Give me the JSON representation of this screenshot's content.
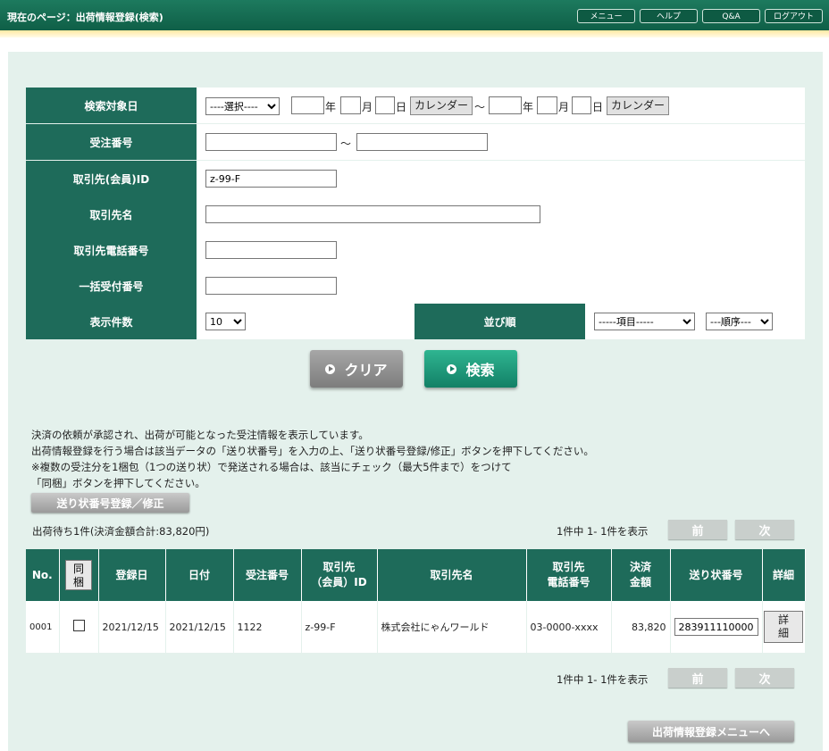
{
  "header": {
    "title": "現在のページ：出荷情報登録(検索)",
    "menu": "メニュー",
    "help": "ヘルプ",
    "qa": "Q&A",
    "logout": "ログアウト"
  },
  "form": {
    "target_date": {
      "label": "検索対象日",
      "select_value": "----選択----",
      "year": "年",
      "month": "月",
      "day": "日",
      "calendar": "カレンダー",
      "tilde": "～"
    },
    "order_no": {
      "label": "受注番号",
      "tilde": "～"
    },
    "client_id": {
      "label": "取引先(会員)ID",
      "value": "z-99-F"
    },
    "client_name": {
      "label": "取引先名"
    },
    "client_phone": {
      "label": "取引先電話番号"
    },
    "bulk_no": {
      "label": "一括受付番号"
    },
    "display_count": {
      "label": "表示件数",
      "value": "10"
    },
    "sort": {
      "label": "並び順",
      "item_value": "-----項目-----",
      "order_value": "---順序---"
    }
  },
  "buttons": {
    "clear": "クリア",
    "search": "検索",
    "register_tracking": "送り状番号登録／修正",
    "prev": "前",
    "next": "次",
    "to_menu": "出荷情報登録メニューへ"
  },
  "info_lines": [
    "決済の依頼が承認され、出荷が可能となった受注情報を表示しています。",
    "出荷情報登録を行う場合は該当データの「送り状番号」を入力の上、「送り状番号登録/修正」ボタンを押下してください。",
    "※複数の受注分を1梱包（1つの送り状）で発送される場合は、該当にチェック（最大5件まで）をつけて",
    "「同梱」ボタンを押下してください。"
  ],
  "summary": "出荷待ち1件(決済金額合計:83,820円)",
  "page_info": "1件中 1- 1件を表示",
  "table": {
    "headers": {
      "no": "No.",
      "bundle": "同梱",
      "reg_date": "登録日",
      "date": "日付",
      "order_no": "受注番号",
      "client_id": "取引先\n（会員）ID",
      "client_name": "取引先名",
      "phone": "取引先\n電話番号",
      "amount": "決済\n金額",
      "tracking": "送り状番号",
      "detail": "詳細"
    },
    "rows": [
      {
        "no": "0001",
        "reg_date": "2021/12/15",
        "date": "2021/12/15",
        "order_no": "1122",
        "client_id": "z-99-F",
        "client_name": "株式会社にゃんワールド",
        "phone": "03-0000-xxxx",
        "amount": "83,820",
        "tracking": "283911110000",
        "detail": "詳細"
      }
    ]
  }
}
